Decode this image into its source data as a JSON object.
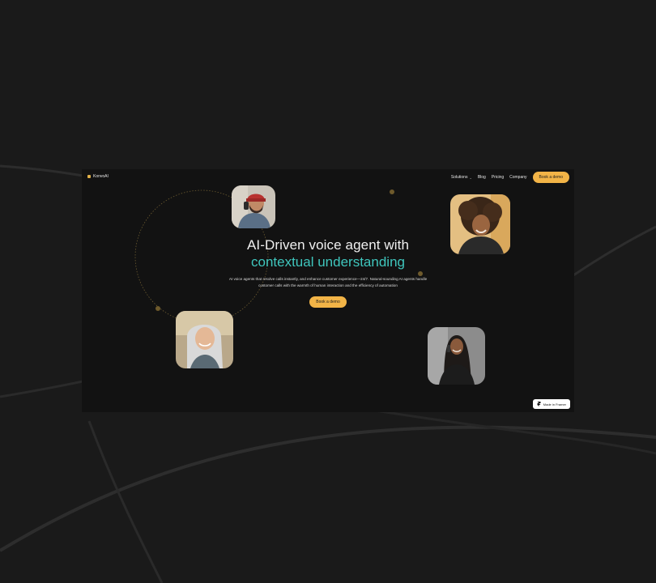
{
  "nav": {
    "logo_text": "KonvoAI",
    "links": [
      "Solutions",
      "Blog",
      "Pricing",
      "Company"
    ],
    "cta": "Book a demo"
  },
  "hero": {
    "title_line1": "AI-Driven voice agent with",
    "title_line2": "contextual understanding",
    "subtitle": "AI voice agents that resolve calls instantly, and enhance customer experience—24/7. Natural-sounding AI agents handle customer calls with the warmth of human interaction and the efficiency of automation",
    "cta": "Book a demo"
  },
  "badge": {
    "label": "Made in Framer"
  },
  "colors": {
    "accent": "#f2b447",
    "highlight": "#3fc6bd",
    "background": "#121212"
  },
  "icons": [
    "framer-icon",
    "chevron-down-icon"
  ]
}
